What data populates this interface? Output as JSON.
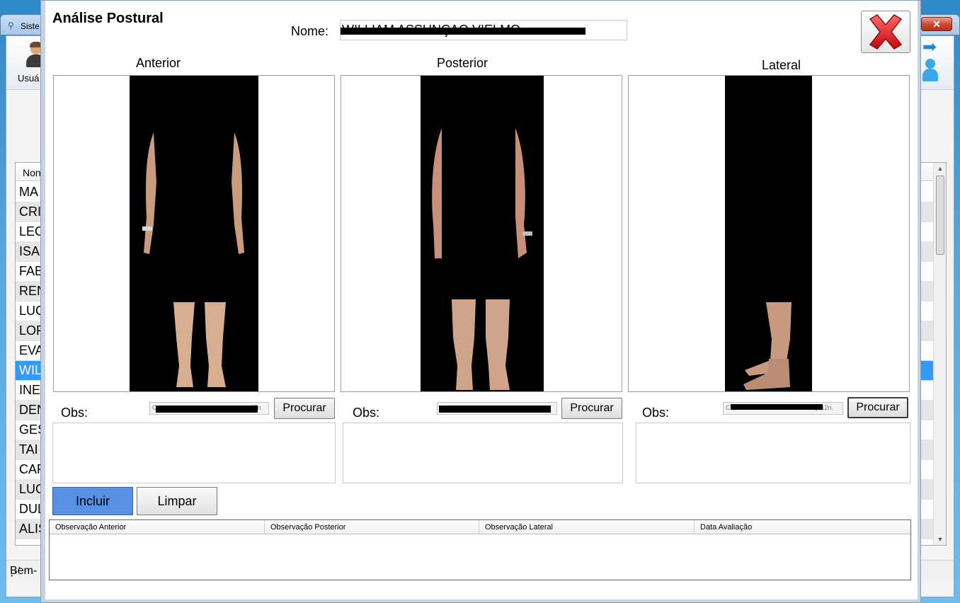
{
  "parent_window": {
    "title": "Siste",
    "close_glyph": "✕",
    "toolbar": {
      "user_button_label": "Usuá"
    },
    "grid": {
      "header": "Non",
      "rows": [
        "MA",
        "CRI",
        "LEO",
        "ISA",
        "FAB",
        "REN",
        "LUC",
        "LOF",
        "EVA",
        "WIL",
        "INE",
        "DEN",
        "GES",
        "TAI",
        "CAF",
        "LUG",
        "DUL",
        "ALIS"
      ],
      "selected_row": "WIL"
    },
    "status_text": "Bem-",
    "grip_glyph": "⋰"
  },
  "modal": {
    "title": "Análise Postural",
    "name_label": "Nome:",
    "name_value": "WILLIAM ASSUNÇAO VIELMO",
    "close_icon": "red-x-icon",
    "views": {
      "anterior": {
        "label": "Anterior",
        "obs_label": "Obs:",
        "path": "C:",
        "path_suffix": "p.27n.",
        "browse_label": "Procurar",
        "obs_text": ""
      },
      "posterior": {
        "label": "Posterior",
        "obs_label": "Obs:",
        "path": "",
        "path_suffix": "",
        "browse_label": "Procurar",
        "obs_text": ""
      },
      "lateral": {
        "label": "Lateral",
        "obs_label": "Obs:",
        "path": "C:\\Users\\DEUMARCOAIDEX\\...p.12n.",
        "path_suffix": "",
        "browse_label": "Procurar",
        "obs_text": ""
      }
    },
    "actions": {
      "include_label": "Incluir",
      "clear_label": "Limpar"
    },
    "grid": {
      "columns": [
        "Observação Anterior",
        "Observação Posterior",
        "Observação Lateral",
        "Data Avaliação"
      ],
      "rows": []
    }
  },
  "colors": {
    "include_button": "#5890e4",
    "selected_row": "#3399ff",
    "close_x": "#e8252a"
  }
}
